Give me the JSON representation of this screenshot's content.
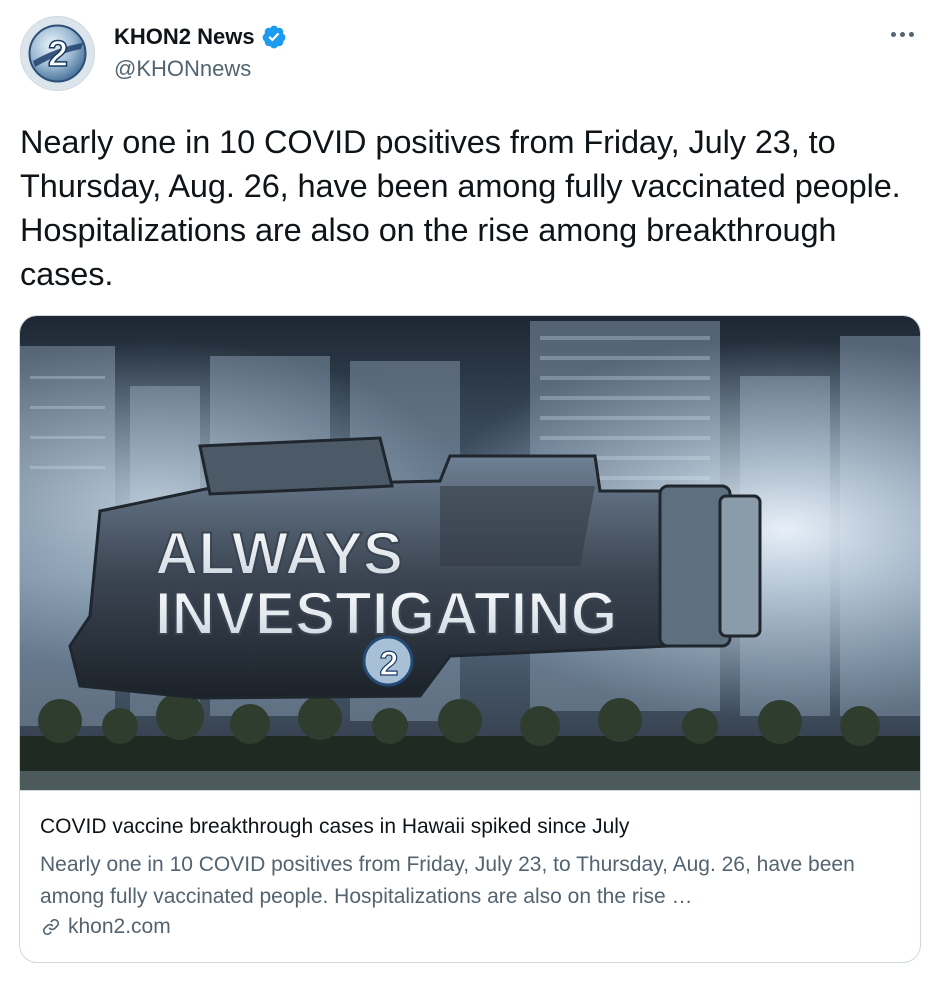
{
  "author": {
    "name": "KHON2 News",
    "handle": "@KHONnews",
    "verified": true,
    "avatar_icon": "khon2-logo-icon"
  },
  "tweet": {
    "text": "Nearly one in 10 COVID positives from Friday, July 23, to Thursday, Aug. 26, have been among fully vaccinated people. Hospitalizations are also on the rise among breakthrough cases."
  },
  "card": {
    "image_text_line1": "ALWAYS",
    "image_text_line2": "INVESTIGATING",
    "image_logo_text": "2",
    "title": "COVID vaccine breakthrough cases in Hawaii spiked since July",
    "description": "Nearly one in 10 COVID positives from Friday, July 23, to Thursday, Aug. 26, have been among fully vaccinated people. Hospitalizations are also on the rise …",
    "domain": "khon2.com",
    "domain_icon": "link-icon"
  },
  "colors": {
    "text": "#0f1419",
    "secondary": "#536471",
    "verified": "#1d9bf0",
    "border": "#cfd9de"
  }
}
